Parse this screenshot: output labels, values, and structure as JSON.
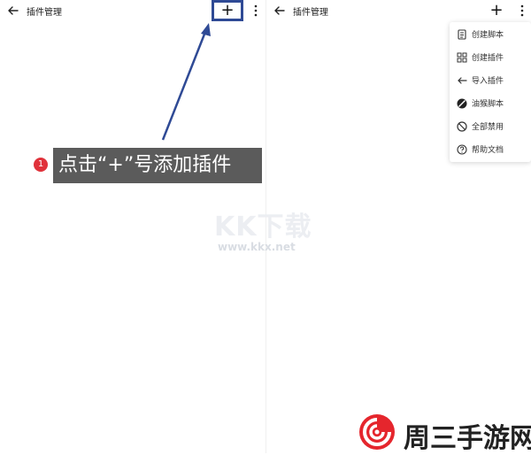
{
  "left_screen": {
    "title": "插件管理",
    "add_label": "+",
    "back_icon": "arrow-left-icon",
    "more_icon": "more-vertical-icon"
  },
  "right_screen": {
    "title": "插件管理",
    "add_label": "+",
    "back_icon": "arrow-left-icon",
    "more_icon": "more-vertical-icon"
  },
  "dropdown_menu": {
    "items": [
      {
        "label": "创建脚本",
        "icon": "script-icon"
      },
      {
        "label": "创建插件",
        "icon": "grid-icon"
      },
      {
        "label": "导入插件",
        "icon": "import-icon"
      },
      {
        "label": "油猴脚本",
        "icon": "tampermonkey-icon"
      },
      {
        "label": "全部禁用",
        "icon": "ban-icon"
      },
      {
        "label": "帮助文档",
        "icon": "help-icon"
      }
    ]
  },
  "tutorial": {
    "step_number": "1",
    "caption": "点击“+”号添加插件",
    "highlight_color": "#2f4a95",
    "badge_color": "#e0323b"
  },
  "watermark": {
    "text": "KK下载",
    "url": "www.kkx.net"
  },
  "logo": {
    "text": "周三手游网",
    "accent_color": "#e5262d"
  }
}
